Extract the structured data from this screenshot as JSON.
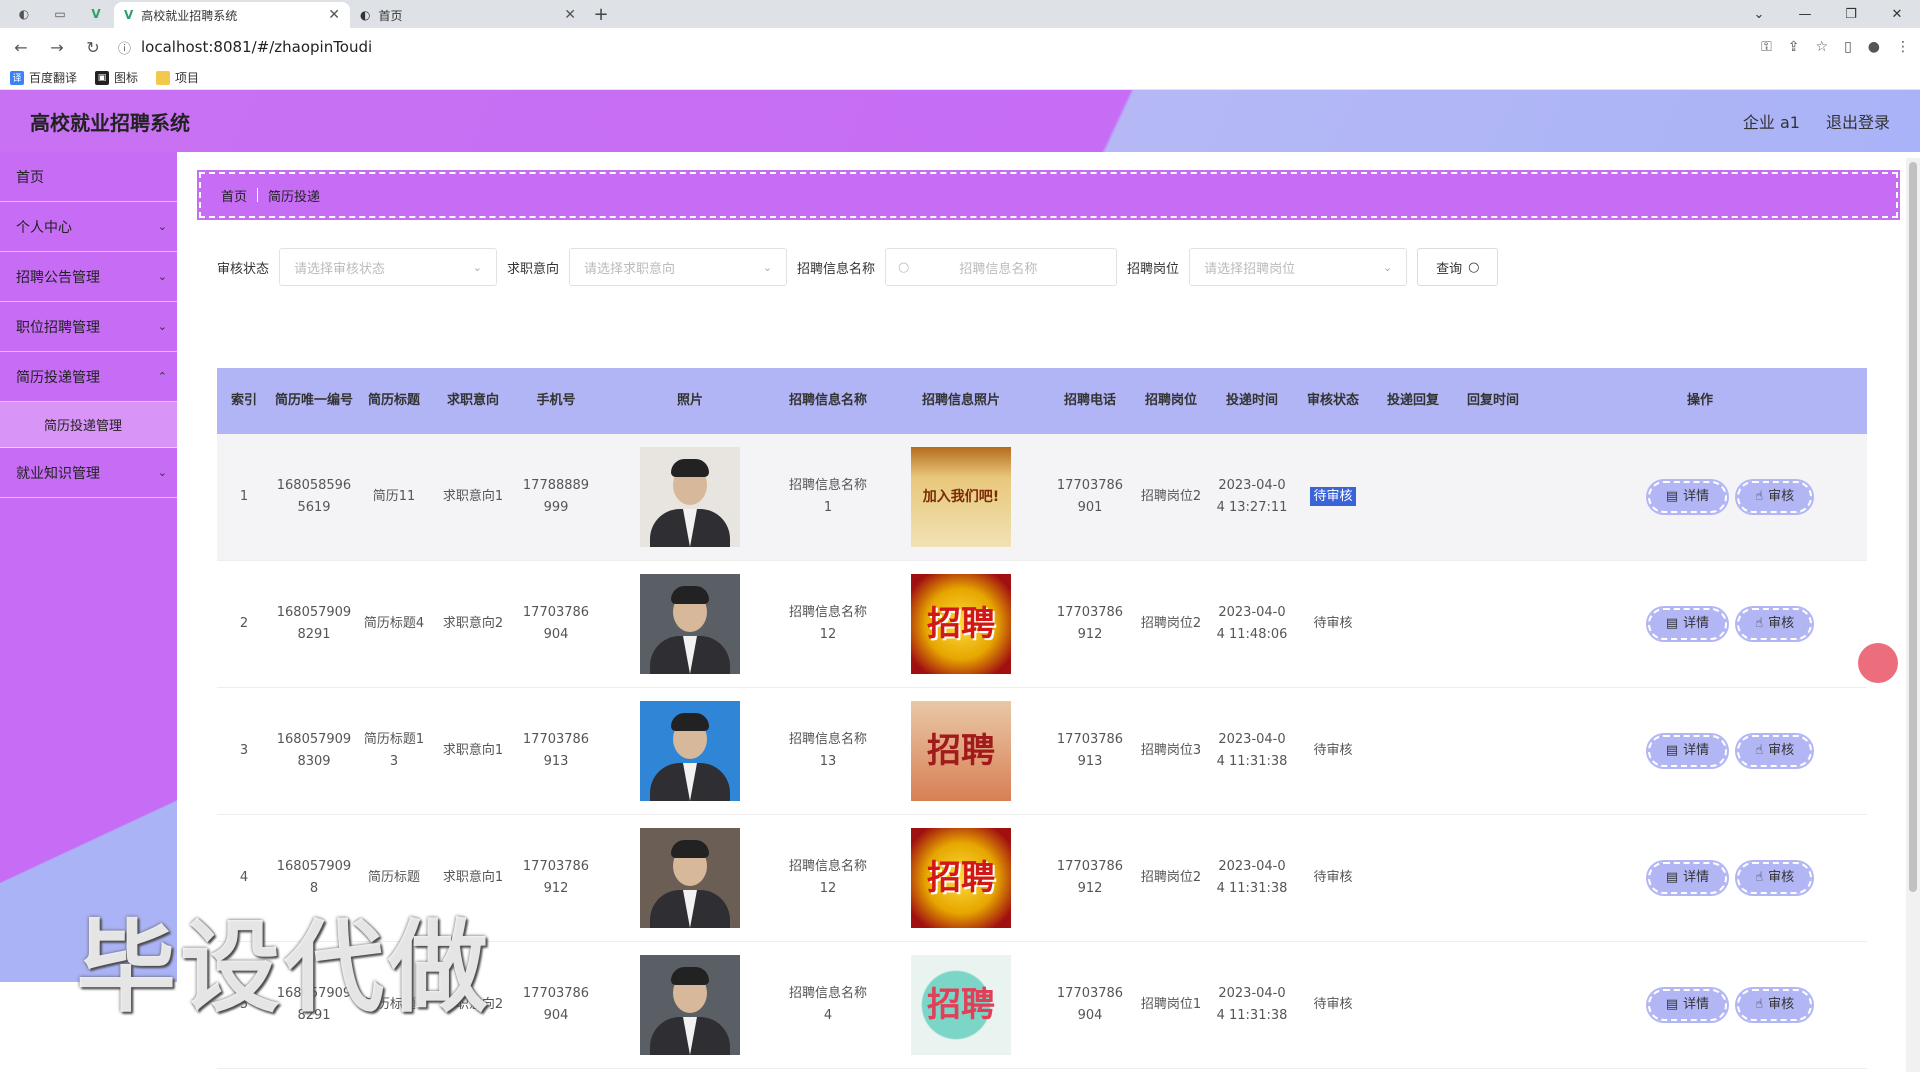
{
  "browser": {
    "tabs": [
      {
        "title": "高校就业招聘系统",
        "active": true
      },
      {
        "title": "首页",
        "active": false
      }
    ],
    "url": "localhost:8081/#/zhaopinToudi",
    "bookmarks": [
      "百度翻译",
      "图标",
      "项目"
    ]
  },
  "header": {
    "title": "高校就业招聘系统",
    "user": "企业 a1",
    "logout": "退出登录"
  },
  "sidebar": {
    "items": [
      {
        "label": "首页",
        "expandable": false
      },
      {
        "label": "个人中心",
        "expandable": true
      },
      {
        "label": "招聘公告管理",
        "expandable": true
      },
      {
        "label": "职位招聘管理",
        "expandable": true
      },
      {
        "label": "简历投递管理",
        "expandable": true
      },
      {
        "label": "就业知识管理",
        "expandable": true
      }
    ],
    "sub_item": "简历投递管理"
  },
  "breadcrumb": {
    "home": "首页",
    "current": "简历投递"
  },
  "filters": {
    "status_label": "审核状态",
    "status_placeholder": "请选择审核状态",
    "intent_label": "求职意向",
    "intent_placeholder": "请选择求职意向",
    "name_label": "招聘信息名称",
    "name_placeholder": "招聘信息名称",
    "post_label": "招聘岗位",
    "post_placeholder": "请选择招聘岗位",
    "query": "查询"
  },
  "table": {
    "headers": [
      "索引",
      "简历唯一编号",
      "简历标题",
      "求职意向",
      "手机号",
      "照片",
      "招聘信息名称",
      "招聘信息照片",
      "招聘电话",
      "招聘岗位",
      "投递时间",
      "审核状态",
      "投递回复",
      "回复时间",
      "操作"
    ],
    "rows": [
      {
        "index": "1",
        "id": "1680585965619",
        "title": "简历11",
        "intent": "求职意向1",
        "phone": "17788889999",
        "info_name": "招聘信息名称1",
        "poster_text": "加入我们吧!",
        "tel": "17703786901",
        "post": "招聘岗位2",
        "time": "2023-04-04 13:27:11",
        "status": "待审核"
      },
      {
        "index": "2",
        "id": "1680579098291",
        "title": "简历标题4",
        "intent": "求职意向2",
        "phone": "17703786904",
        "info_name": "招聘信息名称12",
        "poster_text": "招聘",
        "tel": "17703786912",
        "post": "招聘岗位2",
        "time": "2023-04-04 11:48:06",
        "status": "待审核"
      },
      {
        "index": "3",
        "id": "1680579098309",
        "title": "简历标题13",
        "intent": "求职意向1",
        "phone": "17703786913",
        "info_name": "招聘信息名称13",
        "poster_text": "招聘",
        "tel": "17703786913",
        "post": "招聘岗位3",
        "time": "2023-04-04 11:31:38",
        "status": "待审核"
      },
      {
        "index": "4",
        "id": "1680579098",
        "title": "简历标题",
        "intent": "求职意向1",
        "phone": "17703786912",
        "info_name": "招聘信息名称12",
        "poster_text": "招聘",
        "tel": "17703786912",
        "post": "招聘岗位2",
        "time": "2023-04-04 11:31:38",
        "status": "待审核"
      },
      {
        "index": "5",
        "id": "1680579098291",
        "title": "简历标题4",
        "intent": "求职意向2",
        "phone": "17703786904",
        "info_name": "招聘信息名称4",
        "poster_text": "招聘",
        "tel": "17703786904",
        "post": "招聘岗位1",
        "time": "2023-04-04 11:31:38",
        "status": "待审核"
      }
    ],
    "detail_label": "详情",
    "review_label": "审核"
  },
  "watermark": "毕设代做",
  "colors": {
    "accent": "#c66cf5",
    "table_header": "#b2b5f5",
    "button": "#b3b6f5",
    "highlight": "#3b63d8"
  }
}
